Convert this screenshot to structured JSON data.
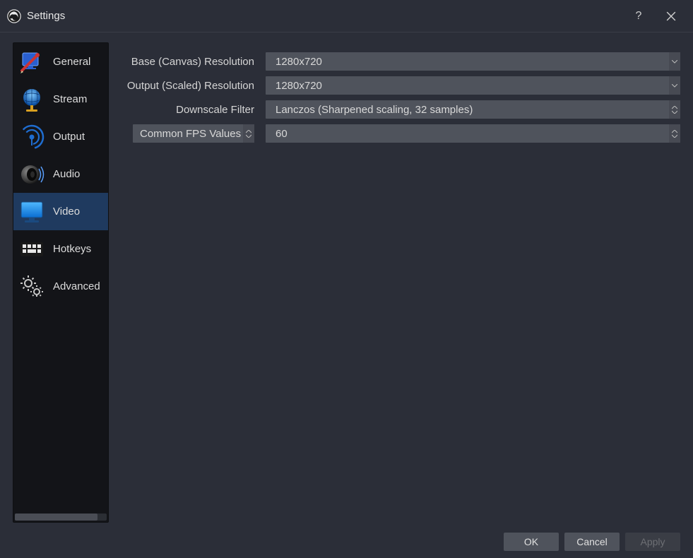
{
  "titlebar": {
    "title": "Settings"
  },
  "sidebar": {
    "items": [
      {
        "label": "General"
      },
      {
        "label": "Stream"
      },
      {
        "label": "Output"
      },
      {
        "label": "Audio"
      },
      {
        "label": "Video"
      },
      {
        "label": "Hotkeys"
      },
      {
        "label": "Advanced"
      }
    ]
  },
  "video": {
    "base_resolution_label": "Base (Canvas) Resolution",
    "base_resolution_value": "1280x720",
    "output_resolution_label": "Output (Scaled) Resolution",
    "output_resolution_value": "1280x720",
    "downscale_filter_label": "Downscale Filter",
    "downscale_filter_value": "Lanczos (Sharpened scaling, 32 samples)",
    "fps_type_label": "Common FPS Values",
    "fps_value": "60"
  },
  "footer": {
    "ok": "OK",
    "cancel": "Cancel",
    "apply": "Apply"
  }
}
